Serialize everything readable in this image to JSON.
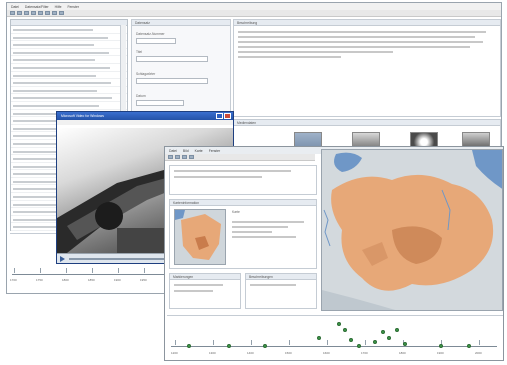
{
  "back_window": {
    "menu": [
      "Datei",
      "Datensatz/Filter",
      "Hilfe",
      "Fenster"
    ],
    "detail_header": "Datensatz",
    "detail_fields": {
      "f1_label": "Datensatz-Nummer",
      "f2_label": "Titel",
      "f3_label": "Schlagwörter",
      "f4_label": "Datum"
    },
    "description_header": "Beschreibung",
    "media_header": "Mediendaten",
    "timeline_ticks": [
      "1700",
      "1750",
      "1800",
      "1850",
      "1900",
      "1950",
      "2000"
    ]
  },
  "video_window": {
    "title": "Microsoft Video for Windows"
  },
  "map_window": {
    "menu": [
      "Datei",
      "Bild",
      "Karte",
      "Fenster"
    ],
    "info_header": "Karteninformation",
    "info_label": "Karte",
    "legend_header": "Markierungen",
    "legend2_header": "Beschreibungen",
    "timeline_ticks": [
      "1200",
      "1300",
      "1400",
      "1500",
      "1600",
      "1700",
      "1800",
      "1900",
      "2000"
    ]
  },
  "colors": {
    "map_region": "#e7a878",
    "map_land": "#cfd6db",
    "water": "#6f97c7",
    "marker": "#3f9b4b"
  }
}
